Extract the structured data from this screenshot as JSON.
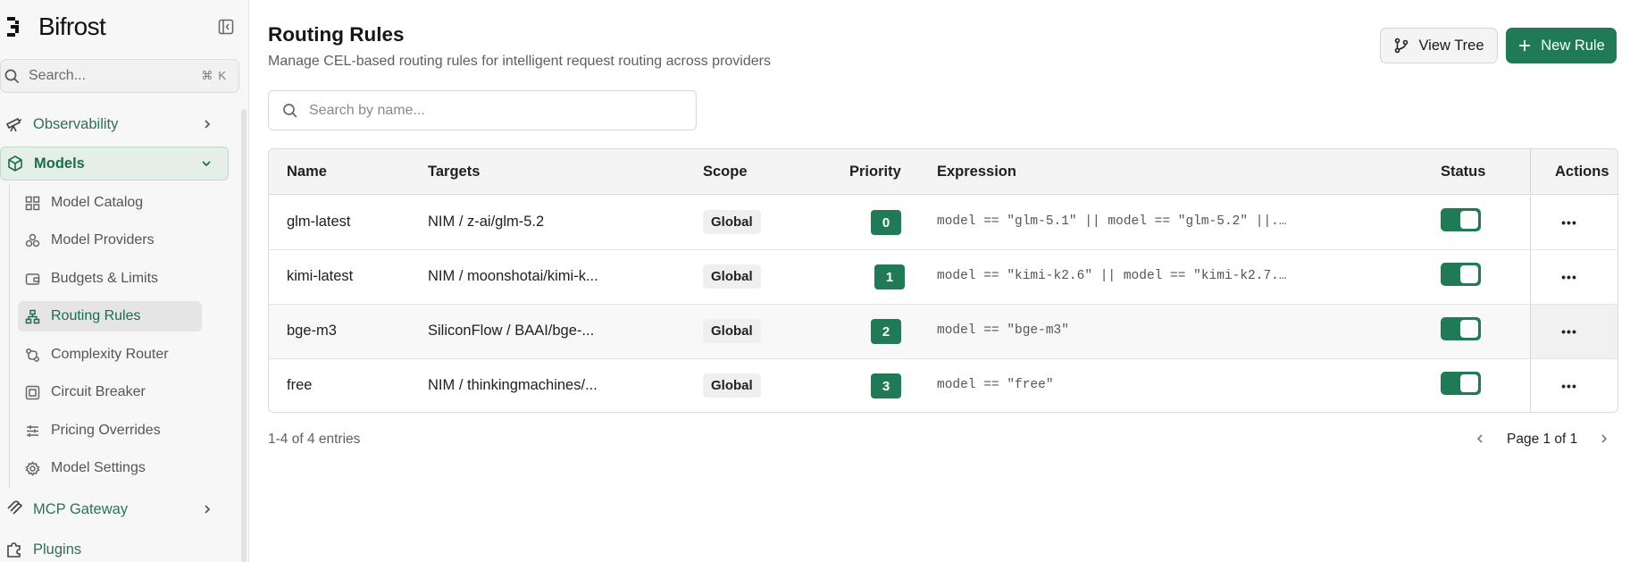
{
  "sidebar": {
    "brand": "Bifrost",
    "search_placeholder": "Search...",
    "search_shortcut": "⌘K",
    "items": [
      {
        "label": "Observability",
        "icon": "telescope-icon",
        "expanded": false
      },
      {
        "label": "Models",
        "icon": "cube-icon",
        "expanded": true,
        "active": true
      },
      {
        "label": "MCP Gateway",
        "icon": "mcp-icon",
        "expanded": false
      },
      {
        "label": "Plugins",
        "icon": "puzzle-icon",
        "expanded": false
      }
    ],
    "subitems": [
      {
        "label": "Model Catalog",
        "icon": "grid-icon"
      },
      {
        "label": "Model Providers",
        "icon": "providers-icon"
      },
      {
        "label": "Budgets & Limits",
        "icon": "wallet-icon"
      },
      {
        "label": "Routing Rules",
        "icon": "routing-icon",
        "active": true
      },
      {
        "label": "Complexity Router",
        "icon": "route-icon"
      },
      {
        "label": "Circuit Breaker",
        "icon": "circuit-icon"
      },
      {
        "label": "Pricing Overrides",
        "icon": "sliders-icon"
      },
      {
        "label": "Model Settings",
        "icon": "gear-icon"
      }
    ]
  },
  "header": {
    "title": "Routing Rules",
    "subtitle": "Manage CEL-based routing rules for intelligent request routing across providers",
    "view_tree_label": "View Tree",
    "new_rule_label": "New Rule"
  },
  "filter": {
    "placeholder": "Search by name..."
  },
  "table": {
    "columns": [
      "Name",
      "Targets",
      "Scope",
      "Priority",
      "Expression",
      "Status",
      "Actions"
    ],
    "rows": [
      {
        "name": "glm-latest",
        "targets": "NIM / z-ai/glm-5.2",
        "scope": "Global",
        "priority": "0",
        "expression": "model == \"glm-5.1\" || model == \"glm-5.2\" ||...",
        "enabled": true
      },
      {
        "name": "kimi-latest",
        "targets": "NIM / moonshotai/kimi-k...",
        "scope": "Global",
        "priority": "1",
        "expression": "model == \"kimi-k2.6\" || model == \"kimi-k2.7...",
        "enabled": true
      },
      {
        "name": "bge-m3",
        "targets": "SiliconFlow / BAAI/bge-...",
        "scope": "Global",
        "priority": "2",
        "expression": "model == \"bge-m3\"",
        "enabled": true
      },
      {
        "name": "free",
        "targets": "NIM / thinkingmachines/...",
        "scope": "Global",
        "priority": "3",
        "expression": "model == \"free\"",
        "enabled": true
      }
    ],
    "actions_label": "•••"
  },
  "footer": {
    "entries": "1-4 of 4 entries",
    "page": "Page 1 of 1"
  },
  "colors": {
    "accent": "#1f7a55",
    "sidebar_bg": "#f7f7f7",
    "active_nav_bg": "#e4efe9"
  }
}
